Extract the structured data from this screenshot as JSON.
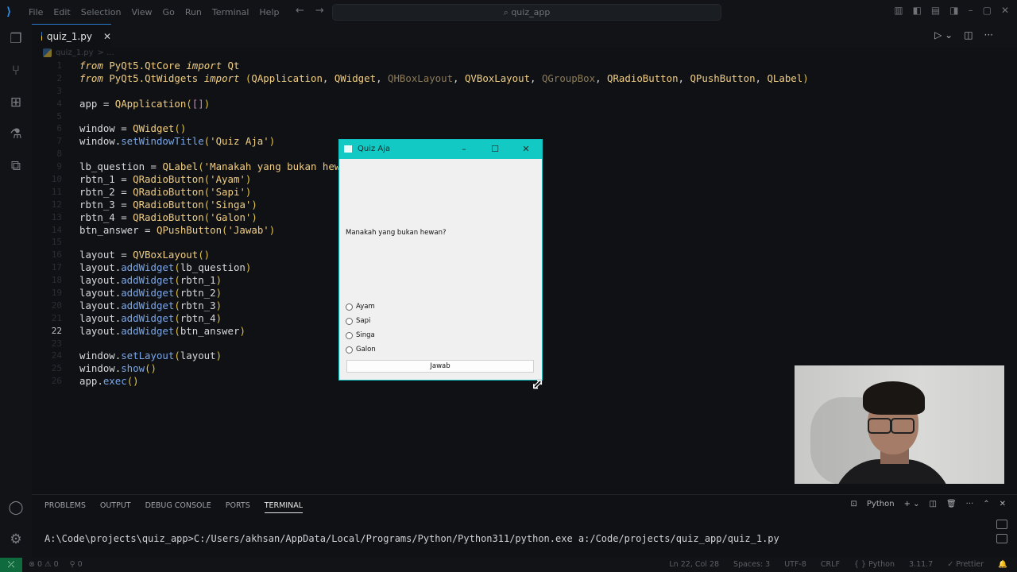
{
  "titlebar": {
    "menu": [
      "File",
      "Edit",
      "Selection",
      "View",
      "Go",
      "Run",
      "Terminal",
      "Help"
    ],
    "search": "quiz_app"
  },
  "editor": {
    "tab_label": "quiz_1.py",
    "breadcrumb": "quiz_1.py",
    "active_line": 22,
    "lines": [
      {
        "n": "1",
        "t": "from PyQt5.QtCore import Qt"
      },
      {
        "n": "2",
        "t": "from PyQt5.QtWidgets import (QApplication, QWidget, QHBoxLayout, QVBoxLayout, QGroupBox, QRadioButton, QPushButton, QLabel)"
      },
      {
        "n": "3",
        "t": ""
      },
      {
        "n": "4",
        "t": "app = QApplication([])"
      },
      {
        "n": "5",
        "t": ""
      },
      {
        "n": "6",
        "t": "window = QWidget()"
      },
      {
        "n": "7",
        "t": "window.setWindowTitle('Quiz Aja')"
      },
      {
        "n": "8",
        "t": ""
      },
      {
        "n": "9",
        "t": "lb_question = QLabel('Manakah yang bukan hewan"
      },
      {
        "n": "10",
        "t": "rbtn_1 = QRadioButton('Ayam')"
      },
      {
        "n": "11",
        "t": "rbtn_2 = QRadioButton('Sapi')"
      },
      {
        "n": "12",
        "t": "rbtn_3 = QRadioButton('Singa')"
      },
      {
        "n": "13",
        "t": "rbtn_4 = QRadioButton('Galon')"
      },
      {
        "n": "14",
        "t": "btn_answer = QPushButton('Jawab')"
      },
      {
        "n": "15",
        "t": ""
      },
      {
        "n": "16",
        "t": "layout = QVBoxLayout()"
      },
      {
        "n": "17",
        "t": "layout.addWidget(lb_question)"
      },
      {
        "n": "18",
        "t": "layout.addWidget(rbtn_1)"
      },
      {
        "n": "19",
        "t": "layout.addWidget(rbtn_2)"
      },
      {
        "n": "20",
        "t": "layout.addWidget(rbtn_3)"
      },
      {
        "n": "21",
        "t": "layout.addWidget(rbtn_4)"
      },
      {
        "n": "22",
        "t": "layout.addWidget(btn_answer)"
      },
      {
        "n": "23",
        "t": ""
      },
      {
        "n": "24",
        "t": "window.setLayout(layout)"
      },
      {
        "n": "25",
        "t": "window.show()"
      },
      {
        "n": "26",
        "t": "app.exec()"
      }
    ]
  },
  "panel": {
    "tabs": [
      "PROBLEMS",
      "OUTPUT",
      "DEBUG CONSOLE",
      "PORTS",
      "TERMINAL"
    ],
    "active_tab": "TERMINAL",
    "shell": "Python",
    "terminal_line": "A:\\Code\\projects\\quiz_app>C:/Users/akhsan/AppData/Local/Programs/Python/Python311/python.exe a:/Code/projects/quiz_app/quiz_1.py"
  },
  "statusbar": {
    "errors": "0",
    "warnings": "0",
    "ports": "0",
    "position": "Ln 22, Col 28",
    "spaces": "Spaces: 3",
    "encoding": "UTF-8",
    "eol": "CRLF",
    "language": "Python",
    "version": "3.11.7",
    "formatter": "Prettier"
  },
  "quiz_window": {
    "title": "Quiz Aja",
    "question": "Manakah yang bukan hewan?",
    "options": [
      "Ayam",
      "Sapi",
      "Singa",
      "Galon"
    ],
    "button": "Jawab"
  },
  "colors": {
    "accent": "#12c9c4",
    "status_remote": "#0f6b3e",
    "keyword": "#f2ce84",
    "method": "#7aa6e8"
  }
}
